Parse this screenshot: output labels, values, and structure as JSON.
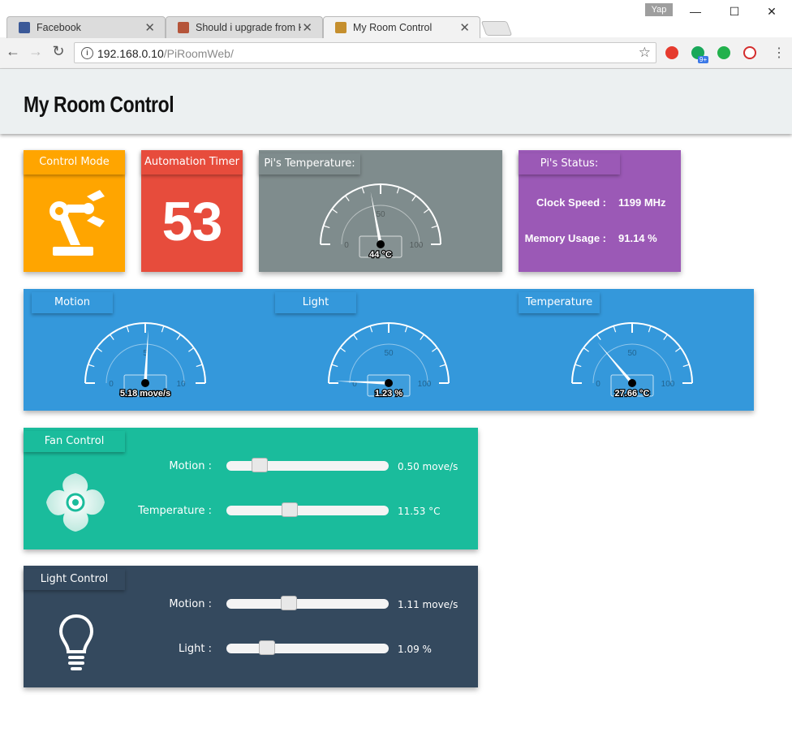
{
  "browser": {
    "tabs": [
      {
        "title": "Facebook",
        "active": false
      },
      {
        "title": "Should i upgrade from H",
        "active": false
      },
      {
        "title": "My Room Control",
        "active": true
      }
    ],
    "profile_name": "Yap",
    "url_host": "192.168.0.10",
    "url_path": "/PiRoomWeb/",
    "extension_badge": "9+"
  },
  "page": {
    "title": "My Room Control"
  },
  "control_mode": {
    "label": "Control Mode",
    "icon": "robot-arm-icon"
  },
  "automation_timer": {
    "label": "Automation Timer",
    "value": "53"
  },
  "pi_temperature": {
    "label": "Pi's Temperature:",
    "value": 44,
    "display": "44 °C",
    "min": "0",
    "mid": "50",
    "max": "100"
  },
  "pi_status": {
    "label": "Pi's Status:",
    "clock_label": "Clock Speed :",
    "clock_value": "1199 MHz",
    "memory_label": "Memory Usage :",
    "memory_value": "91.14 %"
  },
  "sensors": [
    {
      "label": "Motion",
      "value": 5.18,
      "display": "5.18 move/s",
      "min": "0",
      "mid": "5",
      "max": "10",
      "maxnum": 10
    },
    {
      "label": "Light",
      "value": 1.23,
      "display": "1.23 %",
      "min": "0",
      "mid": "50",
      "max": "100",
      "maxnum": 100
    },
    {
      "label": "Temperature",
      "value": 27.66,
      "display": "27.66 °C",
      "min": "0",
      "mid": "50",
      "max": "100",
      "maxnum": 100
    }
  ],
  "fan_control": {
    "label": "Fan Control",
    "icon": "fan-icon",
    "motion_label": "Motion :",
    "motion_display": "0.50 move/s",
    "motion_fraction": 0.17,
    "temperature_label": "Temperature :",
    "temperature_display": "11.53 °C",
    "temperature_fraction": 0.38
  },
  "light_control": {
    "label": "Light Control",
    "icon": "lightbulb-icon",
    "motion_label": "Motion :",
    "motion_display": "1.11 move/s",
    "motion_fraction": 0.37,
    "light_label": "Light :",
    "light_display": "1.09 %",
    "light_fraction": 0.22
  },
  "colors": {
    "orange": "#ffa500",
    "red": "#e74c3c",
    "gray": "#7f8c8d",
    "purple": "#9b59b6",
    "blue": "#3498db",
    "teal": "#1abc9c",
    "navy": "#34495e"
  }
}
